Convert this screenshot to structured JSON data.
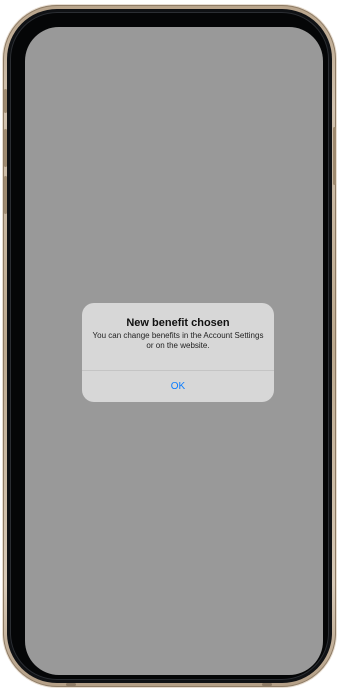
{
  "alert": {
    "title": "New benefit chosen",
    "message": "You can change benefits in the Account Settings or on the website.",
    "button_label": "OK"
  },
  "colors": {
    "screen_overlay": "#999999",
    "alert_background": "#d7d7d7",
    "button_text": "#0a7cff",
    "device_frame": "#c8b59e"
  }
}
